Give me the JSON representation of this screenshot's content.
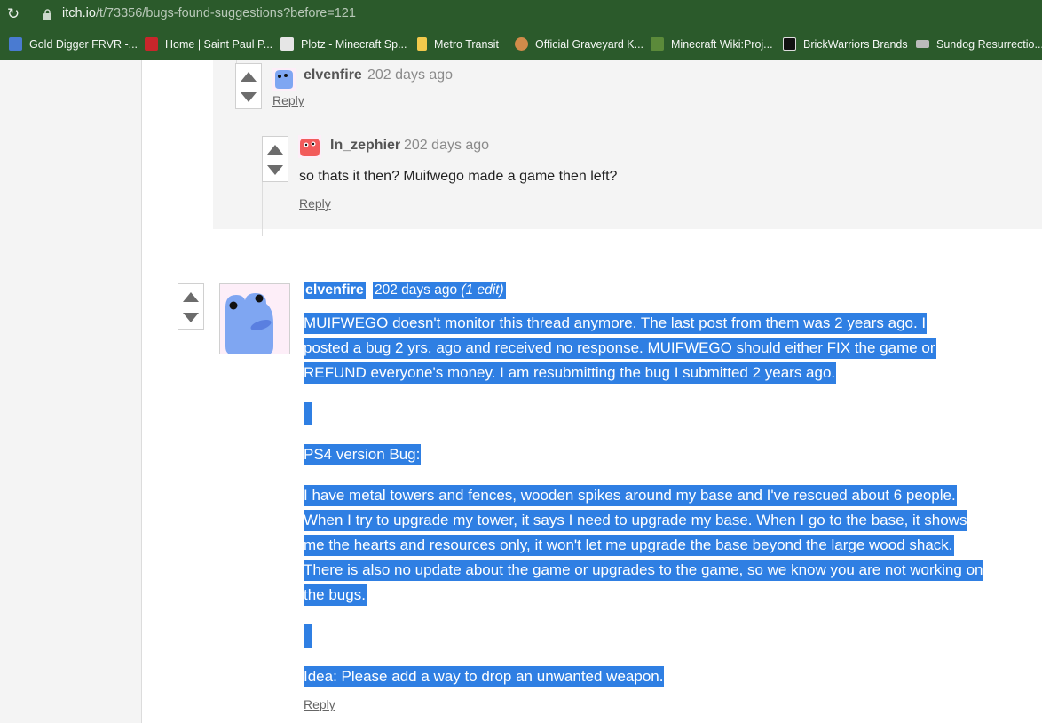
{
  "browser": {
    "url_host": "itch.io",
    "url_path": "/t/73356/bugs-found-suggestions?before=121",
    "bookmarks": [
      {
        "label": "Gold Digger FRVR -...",
        "icon_color": "#4a7bd1"
      },
      {
        "label": "Home | Saint Paul P...",
        "icon_color": "#c8262b"
      },
      {
        "label": "Plotz - Minecraft Sp...",
        "icon_color": "#e6e6e6"
      },
      {
        "label": "Metro Transit",
        "icon_color": "#f2c94c"
      },
      {
        "label": "Official Graveyard K...",
        "icon_color": "#d18b4a"
      },
      {
        "label": "Minecraft Wiki:Proj...",
        "icon_color": "#5b8a3a"
      },
      {
        "label": "BrickWarriors Brands",
        "icon_color": "#111111"
      },
      {
        "label": "Sundog Resurrectio...",
        "icon_color": "#bbbbbb"
      }
    ]
  },
  "thread": {
    "nested_1": {
      "author": "elvenfire",
      "time": "202 days ago",
      "reply_label": "Reply"
    },
    "nested_2": {
      "author": "In_zephier",
      "time": "202 days ago",
      "body": "so thats it then? Muifwego made a game then left?",
      "reply_label": "Reply"
    },
    "main": {
      "author": "elvenfire",
      "time": "202 days ago",
      "edit_note": "(1 edit)",
      "paragraph_1": [
        "MUIFWEGO doesn't monitor this thread anymore.  The last post from them was 2 years ago.  I",
        "posted a bug 2 yrs. ago and received no response. MUIFWEGO should either FIX the game or",
        "REFUND everyone's money. I am resubmitting the bug I submitted 2 years ago."
      ],
      "heading": "PS4 version Bug:",
      "paragraph_2": [
        "I have metal towers and fences, wooden spikes around my base and I've rescued about 6 people.",
        "When I try to upgrade my tower, it says I need to upgrade my base. When I go to the base, it shows",
        "me the hearts and resources only, it won't let me upgrade the base beyond the large wood shack.",
        "There is also no update about the game or upgrades to the game, so we know you are not working on",
        "the bugs."
      ],
      "idea": "Idea: Please add a way to drop an unwanted weapon.",
      "reply_label": "Reply",
      "selection_color": "#2f7fe3"
    }
  }
}
